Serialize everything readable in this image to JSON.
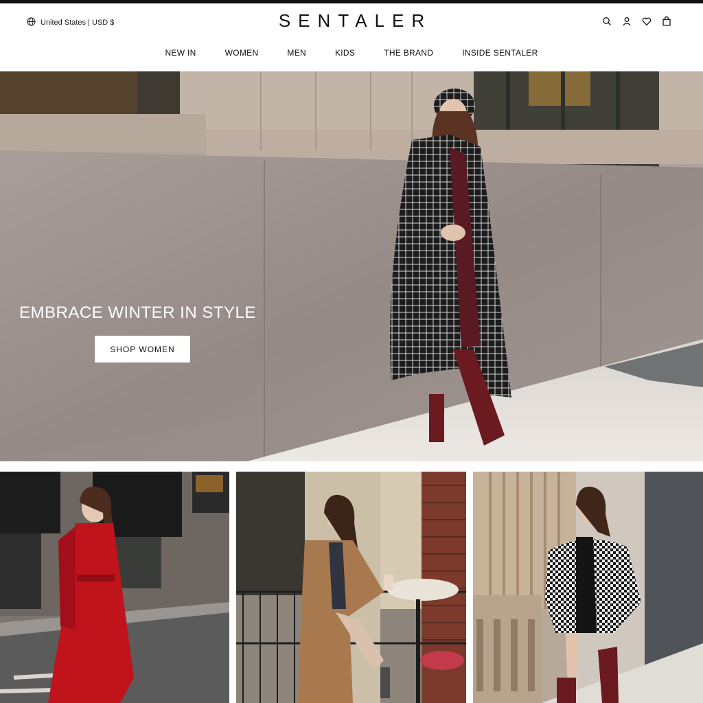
{
  "header": {
    "locale_label": "United States | USD $",
    "logo": "SENTALER",
    "icons": [
      "search-icon",
      "account-icon",
      "wishlist-heart-icon",
      "cart-bag-icon"
    ]
  },
  "nav": {
    "items": [
      {
        "label": "NEW IN"
      },
      {
        "label": "WOMEN"
      },
      {
        "label": "MEN"
      },
      {
        "label": "KIDS"
      },
      {
        "label": "THE BRAND"
      },
      {
        "label": "INSIDE SENTALER"
      }
    ]
  },
  "hero": {
    "title": "EMBRACE WINTER IN STYLE",
    "cta_label": "SHOP WOMEN"
  },
  "colors": {
    "text": "#111111",
    "background": "#ffffff",
    "red_coat": "#c0131c",
    "camel_coat": "#a8794f",
    "burgundy": "#6b1a1f"
  }
}
